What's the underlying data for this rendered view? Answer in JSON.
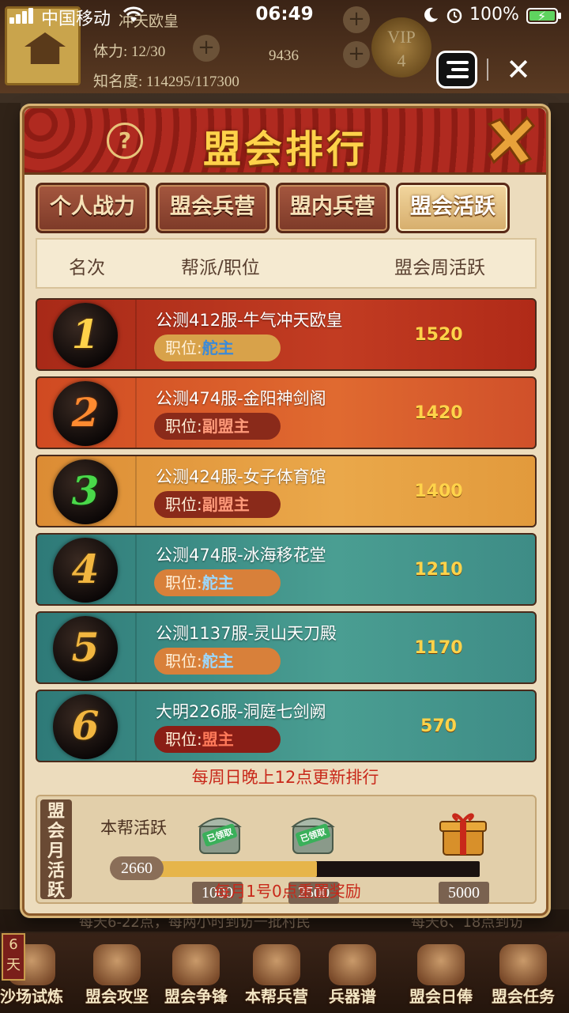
{
  "status_bar": {
    "carrier": "中国移动",
    "time": "06:49",
    "battery": "100%"
  },
  "background": {
    "player_name_partial": "冲天欧皇",
    "stamina": "体力: 12/30",
    "gold": "9436",
    "fame": "知名度: 114295/117300",
    "vip_level": "4",
    "bottom_left_text": "每天6-22点，每两小时到访一批村民",
    "bottom_right_text": "每天6、18点到访",
    "day_badge": "6天"
  },
  "bottom_nav": [
    {
      "label": "沙场试炼"
    },
    {
      "label": "盟会攻坚"
    },
    {
      "label": "盟会争锋"
    },
    {
      "label": "本帮兵营"
    },
    {
      "label": "兵器谱"
    },
    {
      "label": "盟会日俸"
    },
    {
      "label": "盟会任务"
    }
  ],
  "modal": {
    "title": "盟会排行",
    "help": "?",
    "tabs": [
      "个人战力",
      "盟会兵营",
      "盟内兵营",
      "盟会活跃"
    ],
    "active_tab": "盟会活跃",
    "columns": {
      "rank": "名次",
      "guild": "帮派/职位",
      "activity": "盟会周活跃"
    },
    "mine_tag": "本帮",
    "position_label": "职位:",
    "rows": [
      {
        "rank": "1",
        "guild": "公测412服-牛气冲天欧皇",
        "position": "舵主",
        "score": "1520"
      },
      {
        "rank": "2",
        "guild": "公测474服-金阳神剑阁",
        "position": "副盟主",
        "score": "1420"
      },
      {
        "rank": "3",
        "guild": "公测424服-女子体育馆",
        "position": "副盟主",
        "score": "1400"
      },
      {
        "rank": "4",
        "guild": "公测474服-冰海移花堂",
        "position": "舵主",
        "score": "1210"
      },
      {
        "rank": "5",
        "guild": "公测1137服-灵山天刀殿",
        "position": "舵主",
        "score": "1170"
      },
      {
        "rank": "6",
        "guild": "大明226服-洞庭七剑阙",
        "position": "盟主",
        "score": "570"
      }
    ],
    "update_note": "每周日晚上12点更新排行",
    "monthly": {
      "label": "盟会月活跃",
      "own_label": "本帮活跃",
      "own_value": "2660",
      "progress": 0.532,
      "milestones": [
        {
          "value": "1000",
          "badge": "已领取"
        },
        {
          "value": "2500",
          "badge": "已领取"
        },
        {
          "value": "5000",
          "badge": ""
        }
      ],
      "reset_note": "每月1号0点重置奖励"
    }
  },
  "colors": {
    "row_1": "#b8321e",
    "row_2": "#d9582a",
    "row_3": "#e49a3c",
    "row_teal": "#3f8c86",
    "title_gold": "#ffd24a",
    "score_gold": "#ffd34a",
    "note_red": "#c8281a"
  }
}
